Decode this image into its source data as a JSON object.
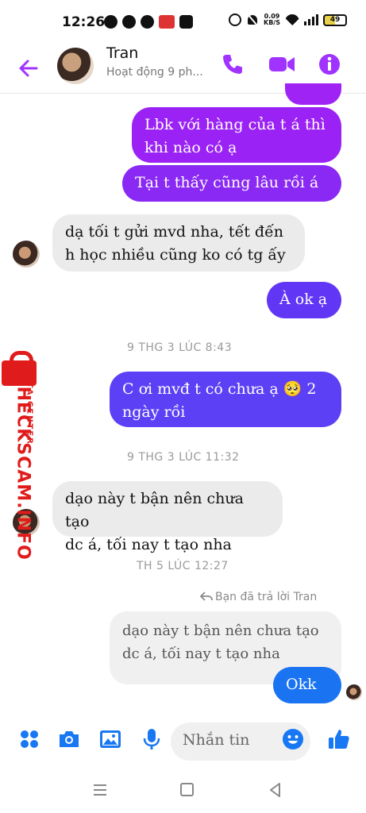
{
  "status_bar": {
    "time": "12:26",
    "net_speed_value": "0.09",
    "net_speed_unit": "KB/S",
    "battery": "49"
  },
  "header": {
    "contact_name": "Tran",
    "contact_status": "Hoạt động 9 ph...",
    "icons": [
      "back-arrow-icon",
      "phone-icon",
      "video-icon",
      "info-icon"
    ],
    "accent_color": "#a033ff"
  },
  "messages": [
    {
      "id": "m1",
      "direction": "out",
      "lines": [
        "Lbk với hàng của t á thì",
        "khi nào có ạ"
      ]
    },
    {
      "id": "m2",
      "direction": "out",
      "lines": [
        "Tại t thấy cũng lâu rồi á"
      ]
    },
    {
      "id": "m3",
      "direction": "in",
      "lines": [
        "dạ tối t gửi mvd nha, tết đến",
        "h học nhiều cũng ko có tg ấy"
      ]
    },
    {
      "id": "m4",
      "direction": "out",
      "lines": [
        "À ok ạ"
      ]
    },
    {
      "id": "t1",
      "timestamp": "9 THG 3 LÚC 8:43"
    },
    {
      "id": "m5",
      "direction": "out",
      "lines": [
        "C ơi mvđ t có chưa ạ 🥺 2",
        "ngày rồi"
      ]
    },
    {
      "id": "t2",
      "timestamp": "9 THG 3 LÚC 11:32"
    },
    {
      "id": "m6",
      "direction": "in",
      "lines": [
        "dạo này t bận nên chưa tạo",
        "dc á, tối nay t tạo nha"
      ]
    },
    {
      "id": "t3",
      "timestamp": "TH 5 LÚC 12:27"
    },
    {
      "id": "r1",
      "reply_note": "Bạn đã trả lời Tran",
      "quoted_lines": [
        "dạo này t bận nên chưa tạo",
        "dc á, tối nay t tạo nha"
      ],
      "reply": "Okk ạ"
    }
  ],
  "watermark": {
    "brand": "CHECKSCAM.INFO",
    "subtitle": "DATA CENTER"
  },
  "composer": {
    "placeholder": "Nhắn tin",
    "icons": [
      "apps-icon",
      "camera-icon",
      "image-icon",
      "mic-icon",
      "emoji-icon",
      "thumbs-up-icon"
    ],
    "icon_color": "#1877f2"
  },
  "colors": {
    "bubble_purple": "#9b22f4",
    "bubble_indigo": "#5b40f5",
    "bubble_blue": "#1a73f0",
    "incoming_bg": "#ebebeb"
  }
}
